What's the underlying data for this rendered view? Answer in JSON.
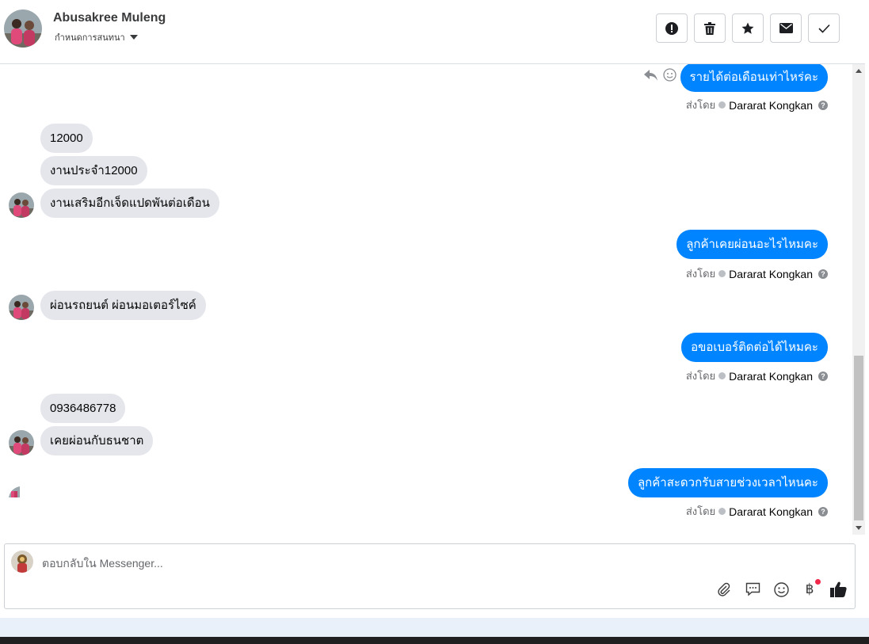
{
  "header": {
    "contact_name": "Abusakree Muleng",
    "assign_label": "กำหนดการสนทนา",
    "toolbar": {
      "spam": "exclamation-icon",
      "delete": "trash-icon",
      "star": "star-icon",
      "unread": "envelope-icon",
      "done": "check-icon"
    }
  },
  "thread": {
    "sent_by_label": "ส่งโดย",
    "agent_name": "Dararat Kongkan",
    "messages": [
      {
        "dir": "out",
        "text": "รายได้ต่อเดือนเท่าไหร่คะ"
      },
      {
        "dir": "in",
        "text": "12000"
      },
      {
        "dir": "in",
        "text": "งานประจำ12000"
      },
      {
        "dir": "in",
        "text": "งานเสริมอีกเจ็ดแปดพันต่อเดือน"
      },
      {
        "dir": "out",
        "text": "ลูกค้าเคยผ่อนอะไรไหมคะ"
      },
      {
        "dir": "in",
        "text": "ผ่อนรถยนต์ ผ่อนมอเตอร์ไซค์"
      },
      {
        "dir": "out",
        "text": "อขอเบอร์ติดต่อได้ไหมคะ"
      },
      {
        "dir": "in",
        "text": "0936486778"
      },
      {
        "dir": "in",
        "text": "เคยผ่อนกับธนชาต"
      },
      {
        "dir": "out",
        "text": "ลูกค้าสะดวกรับสายช่วงเวลาไหนคะ"
      }
    ]
  },
  "composer": {
    "placeholder": "ตอบกลับใน Messenger...",
    "tools": [
      "paperclip-icon",
      "saved-reply-icon",
      "emoji-icon",
      "baht-icon",
      "thumbs-up-icon"
    ],
    "baht_symbol": "฿"
  },
  "colors": {
    "outgoing_bubble": "#0084ff",
    "incoming_bubble": "#e4e6eb",
    "accent": "#0084ff",
    "notification_dot": "#f02849"
  }
}
